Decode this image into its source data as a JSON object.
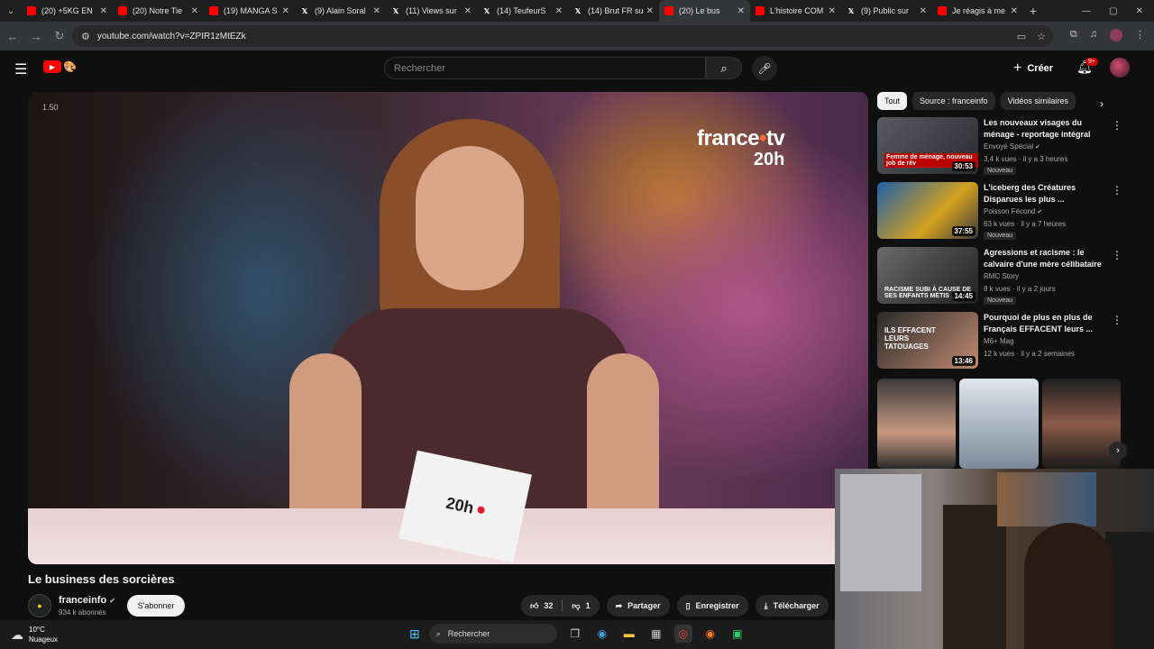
{
  "browser": {
    "tabs": [
      {
        "title": "(20) +5KG EN",
        "icon": "youtube-icon",
        "active": false
      },
      {
        "title": "(20) Notre Tie",
        "icon": "youtube-icon",
        "active": false
      },
      {
        "title": "(19) MANGA S",
        "icon": "youtube-icon",
        "active": false
      },
      {
        "title": "(9) Alain Soral",
        "icon": "x-icon",
        "active": false
      },
      {
        "title": "(11) Views sur",
        "icon": "x-icon",
        "active": false
      },
      {
        "title": "(14) TeufeurS",
        "icon": "x-icon",
        "active": false
      },
      {
        "title": "(14) Brut FR su",
        "icon": "x-icon",
        "active": false
      },
      {
        "title": "(20) Le bus",
        "icon": "youtube-icon",
        "active": true
      },
      {
        "title": "L'histoire COM",
        "icon": "youtube-icon",
        "active": false
      },
      {
        "title": "(9) Public sur",
        "icon": "x-icon",
        "active": false
      },
      {
        "title": "Je réagis à me",
        "icon": "youtube-icon",
        "active": false
      }
    ],
    "url": "youtube.com/watch?v=ZPIR1zMtEZk"
  },
  "youtube": {
    "search_placeholder": "Rechercher",
    "create_label": "Créer",
    "notif_count": "9+"
  },
  "video": {
    "timestamp": "1.50",
    "overlay_brand": "france",
    "overlay_brand_suffix": "tv",
    "overlay_slot": "20h",
    "card_text": "20h",
    "title": "Le business des sorcières",
    "channel": "franceinfo",
    "subscribers": "934 k abonnés",
    "subscribe_label": "S'abonner",
    "likes": "32",
    "dislikes": "1",
    "share_label": "Partager",
    "save_label": "Enregistrer",
    "download_label": "Télécharger"
  },
  "sidebar": {
    "chips": [
      "Tout",
      "Source : franceinfo",
      "Vidéos similaires"
    ],
    "recommendations": [
      {
        "title": "Les nouveaux visages du ménage - reportage intégral",
        "channel": "Envoyé Spécial",
        "meta": "3,4 k vues · il y a 3 heures",
        "duration": "30:53",
        "badge": "Nouveau",
        "caption": "Femme de ménage, nouveau job de rêv"
      },
      {
        "title": "L'iceberg des Créatures Disparues les plus ...",
        "channel": "Poisson Fécond",
        "meta": "63 k vues · il y a 7 heures",
        "duration": "37:55",
        "badge": "Nouveau",
        "caption": ""
      },
      {
        "title": "Agressions et racisme : le calvaire d'une mère célibataire",
        "channel": "RMC Story",
        "meta": "8 k vues · il y a 2 jours",
        "duration": "14:45",
        "badge": "Nouveau",
        "caption": "RACISME SUBI À CAUSE DE SES ENFANTS MÉTIS"
      },
      {
        "title": "Pourquoi de plus en plus de Français EFFACENT leurs ...",
        "channel": "M6+ Mag",
        "meta": "12 k vues · il y a 2 semaines",
        "duration": "13:46",
        "badge": "",
        "caption": "ILS EFFACENT LEURS TATOUAGES"
      }
    ]
  },
  "taskbar": {
    "temp": "10°C",
    "weather": "Nuageux",
    "search_label": "Rechercher"
  }
}
